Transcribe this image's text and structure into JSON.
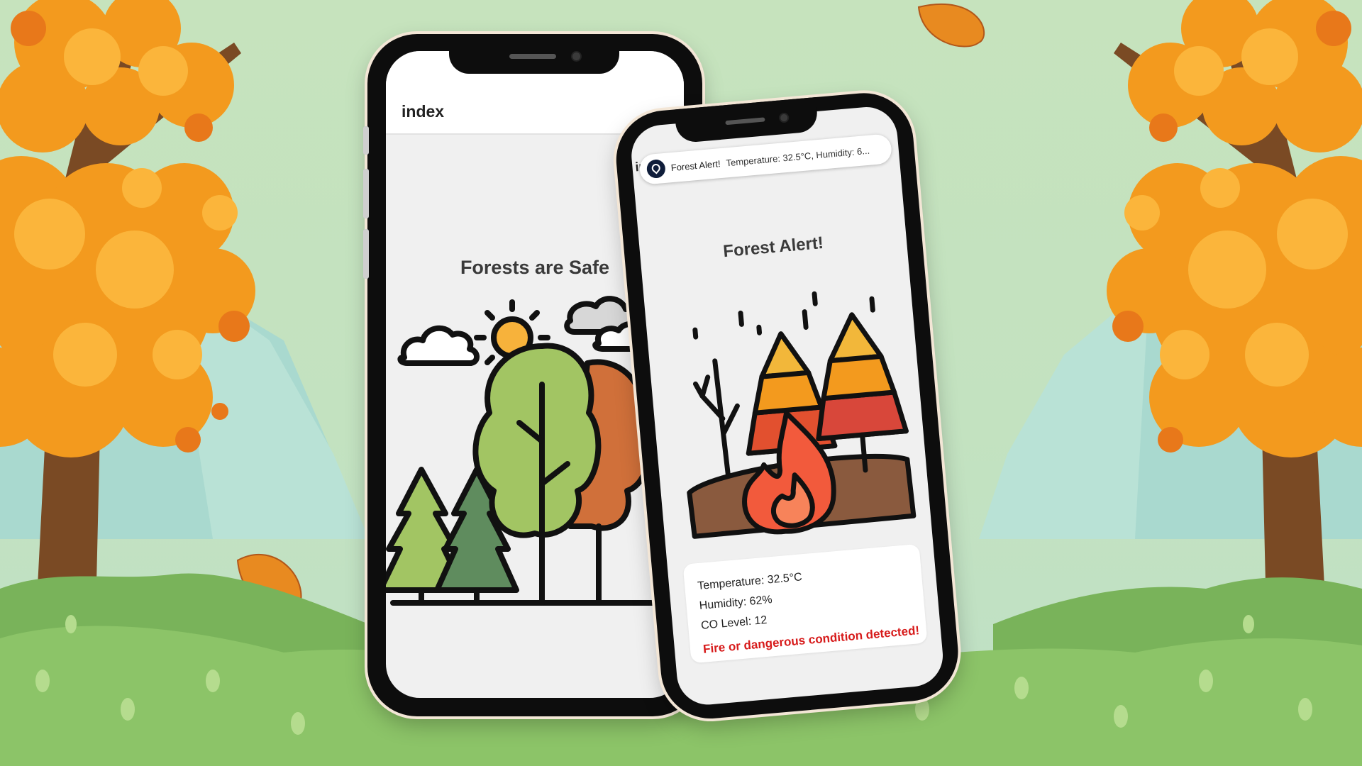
{
  "left_phone": {
    "app_title": "index",
    "status_heading": "Forests are Safe"
  },
  "right_phone": {
    "app_title_peek": "in",
    "notification": {
      "title": "Forest Alert!",
      "body": "Temperature: 32.5°C, Humidity: 6..."
    },
    "status_heading": "Forest Alert!",
    "sensors": {
      "temperature": "Temperature: 32.5°C",
      "humidity": "Humidity: 62%",
      "co_level": "CO Level: 12"
    },
    "warning": "Fire or dangerous condition detected!"
  },
  "colors": {
    "background": "#c6e3bd",
    "phone_frame": "#0d0d0d",
    "screen": "#f0f0f0",
    "warning_text": "#d71b1b",
    "autumn_orange": "#f39a1e"
  },
  "icons": [
    "forest-safe-illustration",
    "forest-fire-illustration",
    "notification-app-icon"
  ]
}
